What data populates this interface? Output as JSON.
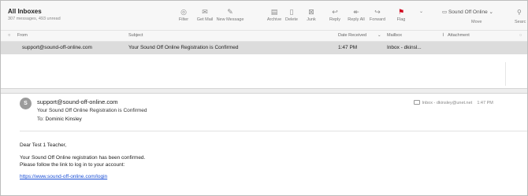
{
  "mailbox": {
    "title": "All Inboxes",
    "subtitle": "307 messages, 493 unread"
  },
  "toolbar": {
    "buttons": [
      {
        "label": "Filter",
        "icon": "filter-icon"
      },
      {
        "label": "Get Mail",
        "icon": "envelope-icon"
      },
      {
        "label": "New Message",
        "icon": "compose-icon"
      },
      {
        "label": "Archive",
        "icon": "archive-icon"
      },
      {
        "label": "Delete",
        "icon": "trash-icon"
      },
      {
        "label": "Junk",
        "icon": "junk-icon"
      },
      {
        "label": "Reply",
        "icon": "reply-icon"
      },
      {
        "label": "Reply All",
        "icon": "reply-all-icon"
      },
      {
        "label": "Forward",
        "icon": "forward-icon"
      },
      {
        "label": "Flag",
        "icon": "flag-icon"
      }
    ],
    "move_to": "Sound Off Online",
    "move_label": "Move",
    "search_label": "Searc"
  },
  "columns": {
    "from": "From",
    "subject": "Subject",
    "date_received": "Date Received",
    "mailbox": "Mailbox",
    "attachment": "Attachment"
  },
  "messages": [
    {
      "from": "support@sound-off-online.com",
      "subject": "Your Sound Off Online Registration is Confirmed",
      "time": "1:47 PM",
      "mailbox": "Inbox - dkinsl..."
    }
  ],
  "message": {
    "avatar_letter": "S",
    "from": "support@sound-off-online.com",
    "subject": "Your Sound Off Online Registration is Confirmed",
    "to_label": "To:",
    "to": "Dominic Kinsley",
    "mailbox": "Inbox - dkinsley@unet.net",
    "time": "1:47 PM",
    "body": {
      "greeting": "Dear Test 1 Teacher,",
      "line1": "Your Sound Off Online registration has been confirmed.",
      "line2": "Please follow the link to log in to your account:",
      "link": "https://www.sound-off-online.com/login"
    }
  },
  "colors": {
    "flag": "#d0021b",
    "selected_row": "#dcdcdc",
    "link": "#1a4fd6"
  }
}
